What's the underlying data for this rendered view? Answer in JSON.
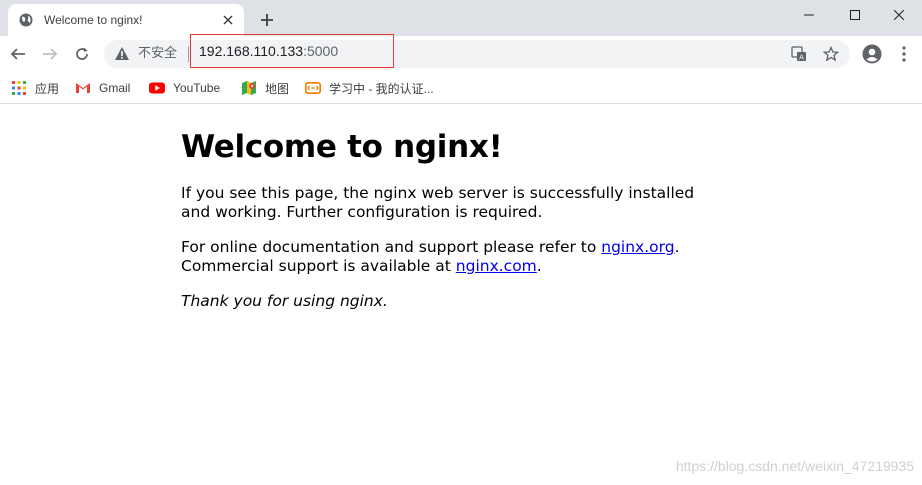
{
  "tab": {
    "title": "Welcome to nginx!"
  },
  "toolbar": {
    "security_text": "不安全",
    "url_host": "192.168.110.133",
    "url_port": ":5000"
  },
  "bookmarks": [
    {
      "label": "应用",
      "icon": "apps-grid-icon"
    },
    {
      "label": "Gmail",
      "icon": "gmail-icon"
    },
    {
      "label": "YouTube",
      "icon": "youtube-icon"
    },
    {
      "label": "地图",
      "icon": "maps-icon"
    },
    {
      "label": "学习中 - 我的认证...",
      "icon": "bookmark-site-icon"
    }
  ],
  "page": {
    "heading": "Welcome to nginx!",
    "p1": "If you see this page, the nginx web server is successfully installed and working. Further configuration is required.",
    "p2_pre": "For online documentation and support please refer to ",
    "link1": "nginx.org",
    "p2_mid": ".",
    "p2_line2": "Commercial support is available at ",
    "link2": "nginx.com",
    "p2_end": ".",
    "thanks": "Thank you for using nginx."
  },
  "watermark": "https://blog.csdn.net/weixin_47219935",
  "colors": {
    "tabstrip_bg": "#dee1e6",
    "omnibox_bg": "#f1f3f4",
    "link": "#0000ee",
    "highlight_box": "#e53935"
  }
}
